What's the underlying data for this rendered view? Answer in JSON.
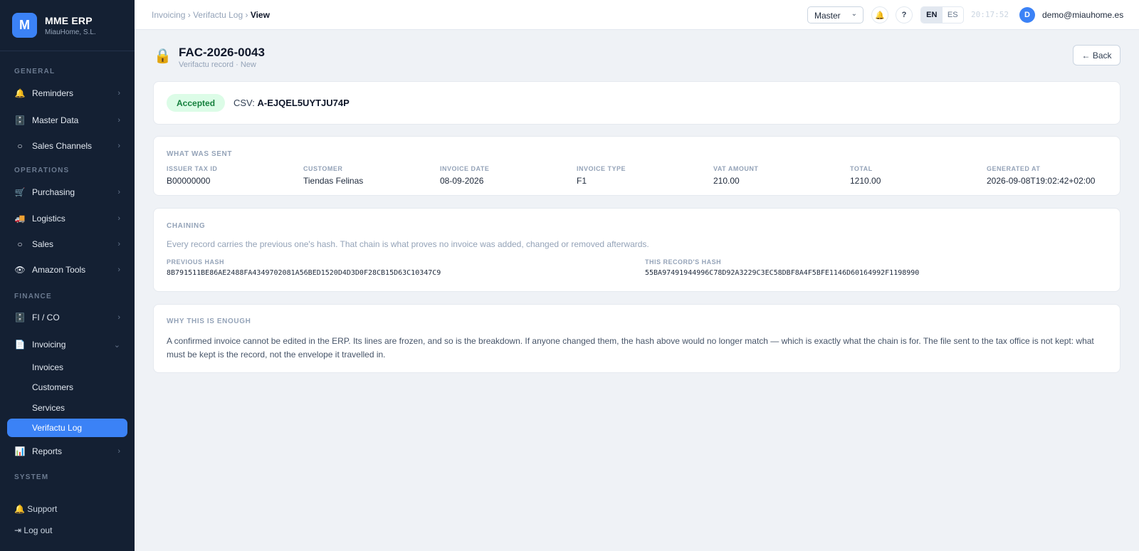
{
  "brand": {
    "logo_letter": "M",
    "name": "MME ERP",
    "company": "MiauHome, S.L."
  },
  "sidebar": {
    "sections": [
      {
        "title": "GENERAL"
      },
      {
        "title": "OPERATIONS"
      },
      {
        "title": "FINANCE"
      },
      {
        "title": "SYSTEM"
      }
    ],
    "items": [
      {
        "label": "Reminders",
        "icon": "🔔",
        "chevron": "›"
      },
      {
        "label": "Master Data",
        "icon": "🗄️",
        "chevron": "›"
      },
      {
        "label": "Sales Channels",
        "icon": "○",
        "chevron": "›"
      },
      {
        "label": "Purchasing",
        "icon": "🛒",
        "chevron": "›"
      },
      {
        "label": "Logistics",
        "icon": "🚚",
        "chevron": "›"
      },
      {
        "label": "Sales",
        "icon": "○",
        "chevron": "›"
      },
      {
        "label": "Amazon Tools",
        "icon": "👁",
        "chevron": "›"
      },
      {
        "label": "FI / CO",
        "icon": "🗄️",
        "chevron": "›"
      },
      {
        "label": "Invoicing",
        "icon": "📄",
        "chevron": "⌄"
      },
      {
        "label": "Reports",
        "icon": "📊",
        "chevron": "›"
      }
    ],
    "invoicing_children": [
      {
        "label": "Invoices"
      },
      {
        "label": "Customers"
      },
      {
        "label": "Services"
      },
      {
        "label": "Verifactu Log"
      }
    ],
    "bottom": {
      "support": "🔔 Support",
      "logout": "⇥ Log out"
    }
  },
  "topbar": {
    "breadcrumb": {
      "part1": "Invoicing",
      "sep": "›",
      "part2": "Verifactu Log",
      "current": "View"
    },
    "environment": "Master",
    "environment_caret": "⌄",
    "bell_icon": "🔔",
    "help": "?",
    "lang_en": "EN",
    "lang_es": "ES",
    "clock": "20:17:52",
    "avatar_letter": "D",
    "user_email": "demo@miauhome.es"
  },
  "page": {
    "lock_icon": "🔒",
    "title": "FAC-2026-0043",
    "subtitle": "Verifactu record · New",
    "back": "← Back"
  },
  "status": {
    "badge": "Accepted",
    "badge_color": "#15803d",
    "csv_label": "CSV:",
    "csv_value": "A-EJQEL5UYTJU74P"
  },
  "sent": {
    "title": "WHAT WAS SENT",
    "fields": [
      {
        "label": "ISSUER TAX ID",
        "value": "B00000000"
      },
      {
        "label": "CUSTOMER",
        "value": "Tiendas Felinas"
      },
      {
        "label": "INVOICE DATE",
        "value": "08-09-2026"
      },
      {
        "label": "INVOICE TYPE",
        "value": "F1"
      },
      {
        "label": "VAT AMOUNT",
        "value": "210.00"
      },
      {
        "label": "TOTAL",
        "value": "1210.00"
      },
      {
        "label": "GENERATED AT",
        "value": "2026-09-08T19:02:42+02:00"
      }
    ]
  },
  "chaining": {
    "title": "CHAINING",
    "description": "Every record carries the previous one's hash. That chain is what proves no invoice was added, changed or removed afterwards.",
    "previous_label": "PREVIOUS HASH",
    "previous_value": "8B791511BE86AE2488FA4349702081A56BED1520D4D3D0F28CB15D63C10347C9",
    "this_label": "THIS RECORD'S HASH",
    "this_value": "55BA97491944996C78D92A3229C3EC58DBF8A4F5BFE1146D60164992F1198990"
  },
  "why": {
    "title": "WHY THIS IS ENOUGH",
    "text": "A confirmed invoice cannot be edited in the ERP. Its lines are frozen, and so is the breakdown. If anyone changed them, the hash above would no longer match — which is exactly what the chain is for. The file sent to the tax office is not kept: what must be kept is the record, not the envelope it travelled in."
  }
}
